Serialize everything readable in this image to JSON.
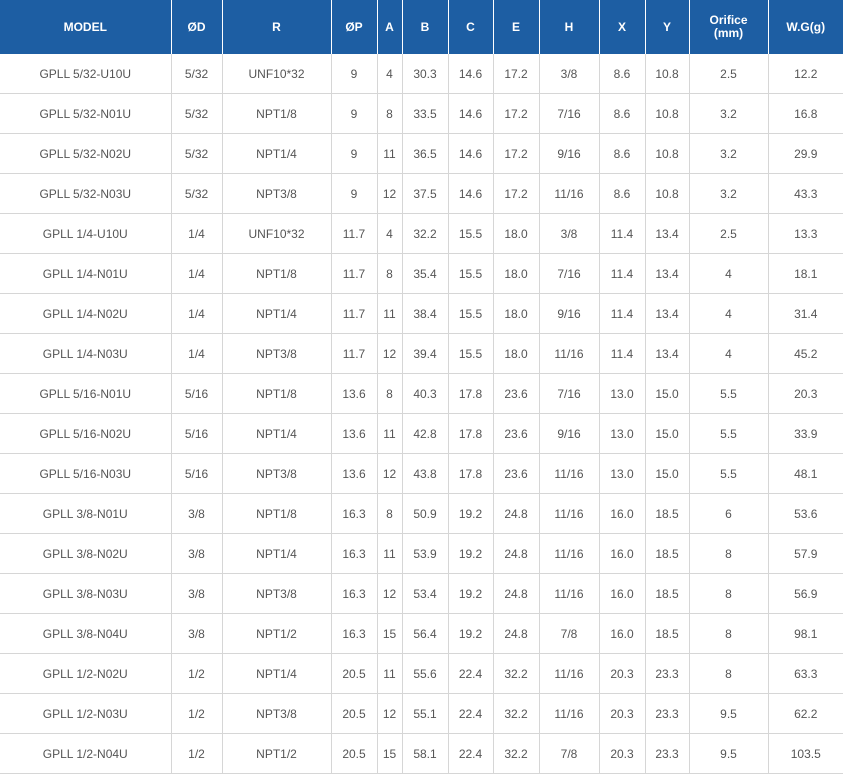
{
  "colors": {
    "header_bg": "#1d5ea3",
    "header_text": "#ffffff",
    "cell_text": "#555555",
    "grid": "#d6d6d6"
  },
  "headers": [
    "MODEL",
    "ØD",
    "R",
    "ØP",
    "A",
    "B",
    "C",
    "E",
    "H",
    "X",
    "Y",
    "Orifice",
    "W.G(g)"
  ],
  "orifice_unit": "(mm)",
  "rows": [
    [
      "GPLL 5/32-U10U",
      "5/32",
      "UNF10*32",
      "9",
      "4",
      "30.3",
      "14.6",
      "17.2",
      "3/8",
      "8.6",
      "10.8",
      "2.5",
      "12.2"
    ],
    [
      "GPLL 5/32-N01U",
      "5/32",
      "NPT1/8",
      "9",
      "8",
      "33.5",
      "14.6",
      "17.2",
      "7/16",
      "8.6",
      "10.8",
      "3.2",
      "16.8"
    ],
    [
      "GPLL 5/32-N02U",
      "5/32",
      "NPT1/4",
      "9",
      "11",
      "36.5",
      "14.6",
      "17.2",
      "9/16",
      "8.6",
      "10.8",
      "3.2",
      "29.9"
    ],
    [
      "GPLL 5/32-N03U",
      "5/32",
      "NPT3/8",
      "9",
      "12",
      "37.5",
      "14.6",
      "17.2",
      "11/16",
      "8.6",
      "10.8",
      "3.2",
      "43.3"
    ],
    [
      "GPLL 1/4-U10U",
      "1/4",
      "UNF10*32",
      "11.7",
      "4",
      "32.2",
      "15.5",
      "18.0",
      "3/8",
      "11.4",
      "13.4",
      "2.5",
      "13.3"
    ],
    [
      "GPLL 1/4-N01U",
      "1/4",
      "NPT1/8",
      "11.7",
      "8",
      "35.4",
      "15.5",
      "18.0",
      "7/16",
      "11.4",
      "13.4",
      "4",
      "18.1"
    ],
    [
      "GPLL 1/4-N02U",
      "1/4",
      "NPT1/4",
      "11.7",
      "11",
      "38.4",
      "15.5",
      "18.0",
      "9/16",
      "11.4",
      "13.4",
      "4",
      "31.4"
    ],
    [
      "GPLL 1/4-N03U",
      "1/4",
      "NPT3/8",
      "11.7",
      "12",
      "39.4",
      "15.5",
      "18.0",
      "11/16",
      "11.4",
      "13.4",
      "4",
      "45.2"
    ],
    [
      "GPLL 5/16-N01U",
      "5/16",
      "NPT1/8",
      "13.6",
      "8",
      "40.3",
      "17.8",
      "23.6",
      "7/16",
      "13.0",
      "15.0",
      "5.5",
      "20.3"
    ],
    [
      "GPLL 5/16-N02U",
      "5/16",
      "NPT1/4",
      "13.6",
      "11",
      "42.8",
      "17.8",
      "23.6",
      "9/16",
      "13.0",
      "15.0",
      "5.5",
      "33.9"
    ],
    [
      "GPLL 5/16-N03U",
      "5/16",
      "NPT3/8",
      "13.6",
      "12",
      "43.8",
      "17.8",
      "23.6",
      "11/16",
      "13.0",
      "15.0",
      "5.5",
      "48.1"
    ],
    [
      "GPLL 3/8-N01U",
      "3/8",
      "NPT1/8",
      "16.3",
      "8",
      "50.9",
      "19.2",
      "24.8",
      "11/16",
      "16.0",
      "18.5",
      "6",
      "53.6"
    ],
    [
      "GPLL 3/8-N02U",
      "3/8",
      "NPT1/4",
      "16.3",
      "11",
      "53.9",
      "19.2",
      "24.8",
      "11/16",
      "16.0",
      "18.5",
      "8",
      "57.9"
    ],
    [
      "GPLL 3/8-N03U",
      "3/8",
      "NPT3/8",
      "16.3",
      "12",
      "53.4",
      "19.2",
      "24.8",
      "11/16",
      "16.0",
      "18.5",
      "8",
      "56.9"
    ],
    [
      "GPLL 3/8-N04U",
      "3/8",
      "NPT1/2",
      "16.3",
      "15",
      "56.4",
      "19.2",
      "24.8",
      "7/8",
      "16.0",
      "18.5",
      "8",
      "98.1"
    ],
    [
      "GPLL 1/2-N02U",
      "1/2",
      "NPT1/4",
      "20.5",
      "11",
      "55.6",
      "22.4",
      "32.2",
      "11/16",
      "20.3",
      "23.3",
      "8",
      "63.3"
    ],
    [
      "GPLL 1/2-N03U",
      "1/2",
      "NPT3/8",
      "20.5",
      "12",
      "55.1",
      "22.4",
      "32.2",
      "11/16",
      "20.3",
      "23.3",
      "9.5",
      "62.2"
    ],
    [
      "GPLL 1/2-N04U",
      "1/2",
      "NPT1/2",
      "20.5",
      "15",
      "58.1",
      "22.4",
      "32.2",
      "7/8",
      "20.3",
      "23.3",
      "9.5",
      "103.5"
    ]
  ]
}
